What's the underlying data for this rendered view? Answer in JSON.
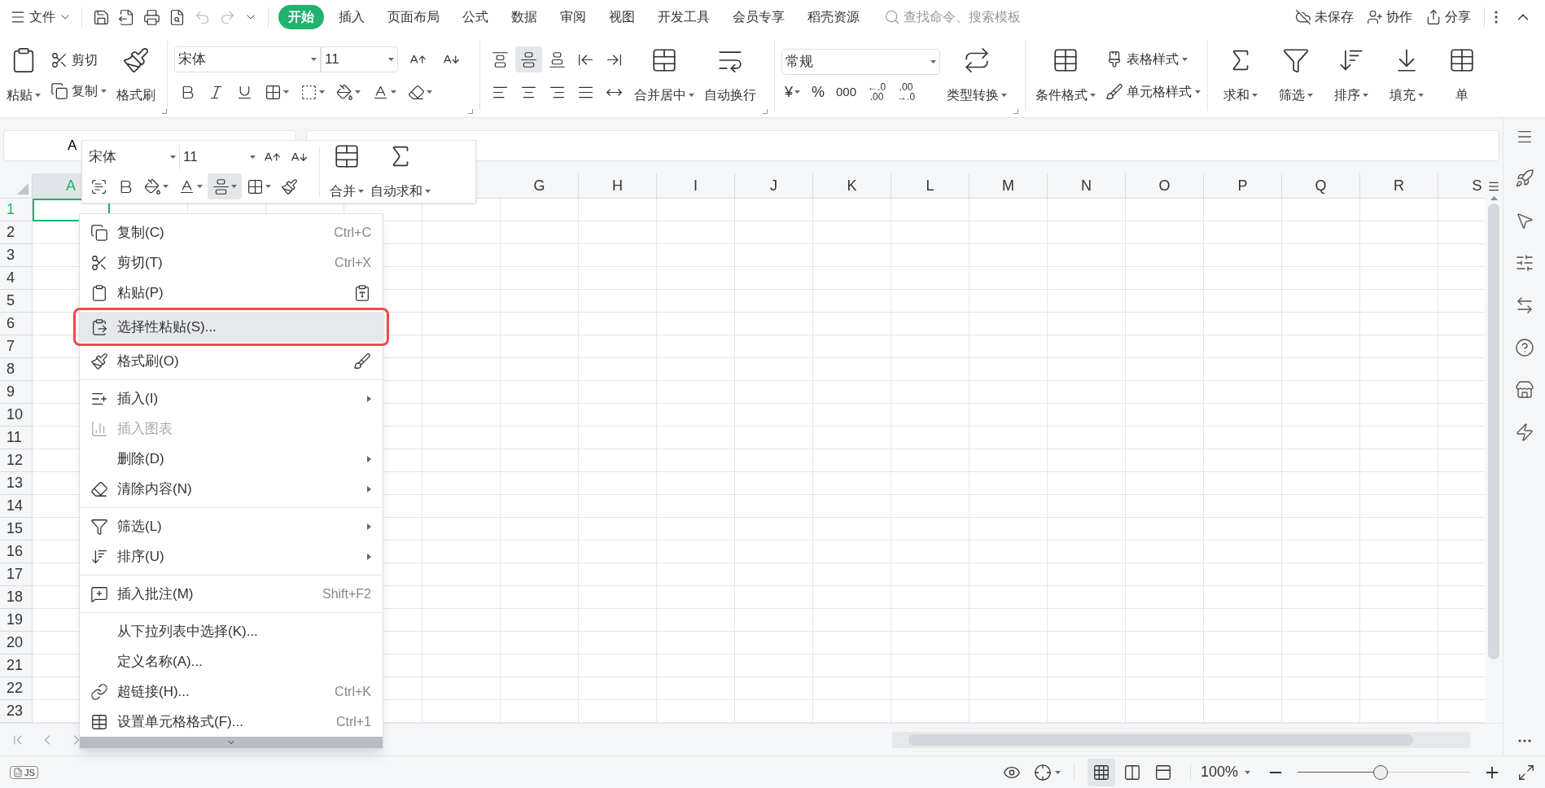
{
  "top_bar": {
    "file_menu": "文件",
    "tabs": [
      {
        "label": "开始",
        "selected": true
      },
      {
        "label": "插入",
        "selected": false
      },
      {
        "label": "页面布局",
        "selected": false
      },
      {
        "label": "公式",
        "selected": false
      },
      {
        "label": "数据",
        "selected": false
      },
      {
        "label": "审阅",
        "selected": false
      },
      {
        "label": "视图",
        "selected": false
      },
      {
        "label": "开发工具",
        "selected": false
      },
      {
        "label": "会员专享",
        "selected": false
      },
      {
        "label": "稻壳资源",
        "selected": false
      }
    ],
    "search": {
      "placeholder": "查找命令、搜索模板"
    },
    "unsaved": "未保存",
    "collaborate": "协作",
    "share": "分享"
  },
  "ribbon": {
    "clipboard": {
      "paste": "粘贴",
      "cut": "剪切",
      "copy": "复制",
      "format_painter": "格式刷"
    },
    "font": {
      "name": "宋体",
      "size": "11"
    },
    "alignment": {
      "buttons": [
        {
          "selected": false
        },
        {
          "selected": true
        },
        {
          "selected": false
        },
        {
          "selected": false
        },
        {
          "selected": false
        },
        {
          "selected": false
        },
        {
          "selected": false
        },
        {
          "selected": false
        },
        {
          "selected": false
        },
        {
          "selected": false
        }
      ],
      "merge": "合并居中",
      "wrap": "自动换行"
    },
    "number": {
      "format": "常规",
      "currency": "¥",
      "percent": "%",
      "thousands": "000",
      "increase_decimal": {
        "top": "←.0",
        "bottom": ".00"
      },
      "decrease_decimal": {
        "top": ".00",
        "bottom": "→.0"
      },
      "convert": "类型转换"
    },
    "styles": {
      "conditional": "条件格式",
      "table_style": "表格样式",
      "cell_style": "单元格样式"
    },
    "editing": [
      {
        "label": "求和"
      },
      {
        "label": "筛选"
      },
      {
        "label": "排序"
      },
      {
        "label": "填充"
      },
      {
        "label": "单"
      }
    ]
  },
  "name_box": {
    "value": "A"
  },
  "mini_toolbar": {
    "font": "宋体",
    "size": "11",
    "buttons": [
      {
        "selected": false
      },
      {
        "selected": false
      },
      {
        "selected": false
      },
      {
        "selected": false
      },
      {
        "selected": true
      },
      {
        "selected": false
      },
      {
        "selected": false
      }
    ],
    "merge": "合并",
    "autosum": "自动求和"
  },
  "columns": [
    {
      "label": "A",
      "selected": true
    },
    {
      "label": "G",
      "selected": false
    },
    {
      "label": "H",
      "selected": false
    },
    {
      "label": "I",
      "selected": false
    },
    {
      "label": "J",
      "selected": false
    },
    {
      "label": "K",
      "selected": false
    },
    {
      "label": "L",
      "selected": false
    },
    {
      "label": "M",
      "selected": false
    },
    {
      "label": "N",
      "selected": false
    },
    {
      "label": "O",
      "selected": false
    },
    {
      "label": "P",
      "selected": false
    },
    {
      "label": "Q",
      "selected": false
    },
    {
      "label": "R",
      "selected": false
    },
    {
      "label": "S",
      "selected": false
    }
  ],
  "rows": [
    {
      "label": "1",
      "selected": true
    },
    {
      "label": "2",
      "selected": false
    },
    {
      "label": "3",
      "selected": false
    },
    {
      "label": "4",
      "selected": false
    },
    {
      "label": "5",
      "selected": false
    },
    {
      "label": "6",
      "selected": false
    },
    {
      "label": "7",
      "selected": false
    },
    {
      "label": "8",
      "selected": false
    },
    {
      "label": "9",
      "selected": false
    },
    {
      "label": "10",
      "selected": false
    },
    {
      "label": "11",
      "selected": false
    },
    {
      "label": "12",
      "selected": false
    },
    {
      "label": "13",
      "selected": false
    },
    {
      "label": "14",
      "selected": false
    },
    {
      "label": "15",
      "selected": false
    },
    {
      "label": "16",
      "selected": false
    },
    {
      "label": "17",
      "selected": false
    },
    {
      "label": "18",
      "selected": false
    },
    {
      "label": "19",
      "selected": false
    },
    {
      "label": "20",
      "selected": false
    },
    {
      "label": "21",
      "selected": false
    },
    {
      "label": "22",
      "selected": false
    },
    {
      "label": "23",
      "selected": false
    }
  ],
  "context_menu": [
    {
      "kind": "item",
      "label": "复制(C)",
      "shortcut": "Ctrl+C",
      "submenu": false,
      "disabled": false,
      "selected": false,
      "outlined": false
    },
    {
      "kind": "item",
      "label": "剪切(T)",
      "shortcut": "Ctrl+X",
      "submenu": false,
      "disabled": false,
      "selected": false,
      "outlined": false
    },
    {
      "kind": "item",
      "label": "粘贴(P)",
      "submenu": false,
      "disabled": false,
      "selected": false,
      "outlined": false
    },
    {
      "kind": "item",
      "label": "选择性粘贴(S)...",
      "submenu": false,
      "disabled": false,
      "selected": true,
      "outlined": true
    },
    {
      "kind": "item",
      "label": "格式刷(O)",
      "submenu": false,
      "disabled": false,
      "selected": false,
      "outlined": false
    },
    {
      "kind": "divider"
    },
    {
      "kind": "item",
      "label": "插入(I)",
      "submenu": true,
      "disabled": false,
      "selected": false,
      "outlined": false
    },
    {
      "kind": "item",
      "label": "插入图表",
      "submenu": false,
      "disabled": true,
      "selected": false,
      "outlined": false
    },
    {
      "kind": "item",
      "label": "删除(D)",
      "submenu": true,
      "disabled": false,
      "selected": false,
      "outlined": false
    },
    {
      "kind": "item",
      "label": "清除内容(N)",
      "submenu": true,
      "disabled": false,
      "selected": false,
      "outlined": false
    },
    {
      "kind": "divider"
    },
    {
      "kind": "item",
      "label": "筛选(L)",
      "submenu": true,
      "disabled": false,
      "selected": false,
      "outlined": false
    },
    {
      "kind": "item",
      "label": "排序(U)",
      "submenu": true,
      "disabled": false,
      "selected": false,
      "outlined": false
    },
    {
      "kind": "divider"
    },
    {
      "kind": "item",
      "label": "插入批注(M)",
      "shortcut": "Shift+F2",
      "submenu": false,
      "disabled": false,
      "selected": false,
      "outlined": false
    },
    {
      "kind": "divider"
    },
    {
      "kind": "item",
      "label": "从下拉列表中选择(K)...",
      "submenu": false,
      "disabled": false,
      "selected": false,
      "outlined": false
    },
    {
      "kind": "item",
      "label": "定义名称(A)...",
      "submenu": false,
      "disabled": false,
      "selected": false,
      "outlined": false
    },
    {
      "kind": "item",
      "label": "超链接(H)...",
      "shortcut": "Ctrl+K",
      "submenu": false,
      "disabled": false,
      "selected": false,
      "outlined": false
    },
    {
      "kind": "item",
      "label": "设置单元格格式(F)...",
      "shortcut": "Ctrl+1",
      "submenu": false,
      "disabled": false,
      "selected": false,
      "outlined": false
    }
  ],
  "status_bar": {
    "macro": "JS",
    "views": [
      {
        "selected": true
      },
      {
        "selected": false
      },
      {
        "selected": false
      }
    ],
    "zoom": {
      "value": "100%",
      "level": 0.48
    }
  }
}
